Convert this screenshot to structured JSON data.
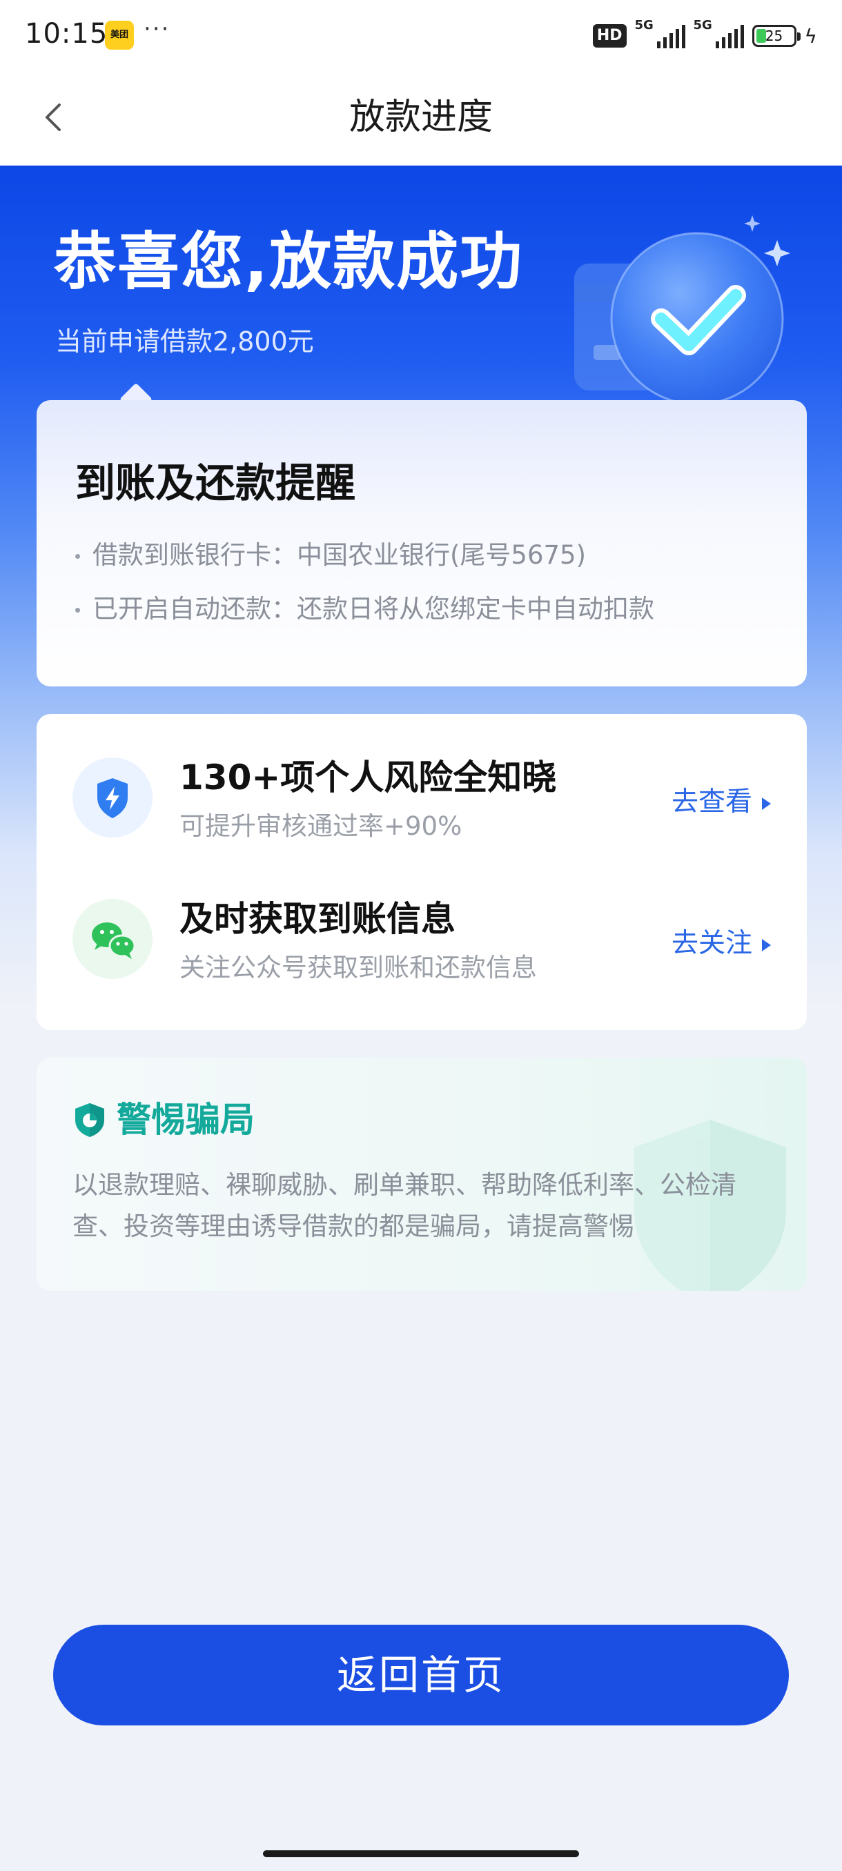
{
  "status_bar": {
    "time": "10:15",
    "app_icon_label": "美团",
    "more": "···",
    "hd_label": "HD",
    "network_1": "5G",
    "network_2": "5G",
    "battery": "25"
  },
  "nav": {
    "title": "放款进度",
    "back_icon": "chevron-left-icon"
  },
  "hero": {
    "title": "恭喜您,放款成功",
    "subtitle": "当前申请借款2,800元",
    "illustration_icon": "success-check-icon"
  },
  "remind_card": {
    "title": "到账及还款提醒",
    "items": [
      "借款到账银行卡：中国农业银行(尾号5675)",
      "已开启自动还款：还款日将从您绑定卡中自动扣款"
    ]
  },
  "services": [
    {
      "icon": "shield-bolt-icon",
      "title": "130+项个人风险全知晓",
      "subtitle": "可提升审核通过率+90%",
      "link": "去查看"
    },
    {
      "icon": "wechat-icon",
      "title": "及时获取到账信息",
      "subtitle": "关注公众号获取到账和还款信息",
      "link": "去关注"
    }
  ],
  "fraud_card": {
    "title": "警惕骗局",
    "text": "以退款理赔、裸聊威胁、刷单兼职、帮助降低利率、公检清查、投资等理由诱导借款的都是骗局，请提高警惕"
  },
  "bottom_button": {
    "label": "返回首页"
  },
  "colors": {
    "primary": "#1b4fe4",
    "link": "#2a66e6",
    "fraud_accent": "#13a99b",
    "background": "#eff2f8"
  }
}
